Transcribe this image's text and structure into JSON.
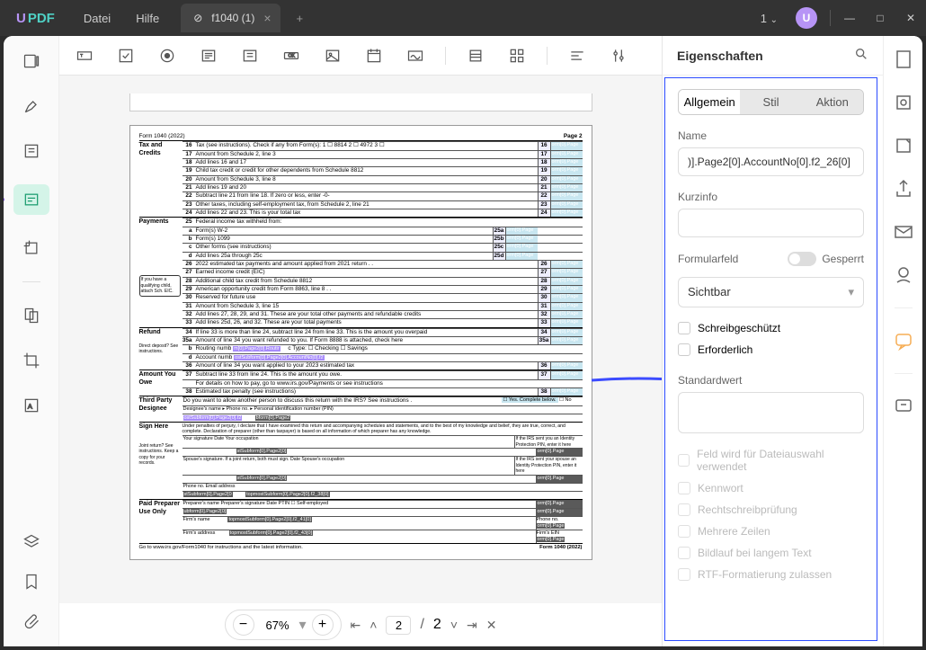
{
  "titlebar": {
    "brand_u": "U",
    "brand_pdf": "PDF",
    "menu_file": "Datei",
    "menu_help": "Hilfe",
    "tab_title": "f1040 (1)",
    "pagecount": "1",
    "avatar": "U"
  },
  "toolbar_icons": [
    "text-field",
    "checkbox",
    "radio",
    "dropdown",
    "listbox",
    "button",
    "image",
    "date",
    "signature",
    "sep",
    "list",
    "grid",
    "sep",
    "align",
    "settings"
  ],
  "leftsidebar_icons": [
    "thumbnails",
    "highlighter",
    "edit-text",
    "form-field",
    "crop-tool",
    "page-organize",
    "crop",
    "ocr"
  ],
  "leftsidebar_bottom": [
    "layers",
    "bookmark",
    "attachment"
  ],
  "rightstrip_icons": [
    "page-icon",
    "stamp-icon",
    "signature-icon",
    "share-icon",
    "mail-icon",
    "save-icon",
    "settings-icon",
    "sep",
    "chat-icon",
    "sep",
    "feedback-icon"
  ],
  "right": {
    "title": "Eigenschaften",
    "tabs": {
      "general": "Allgemein",
      "style": "Stil",
      "action": "Aktion"
    },
    "name_label": "Name",
    "name_value": ")].Page2[0].AccountNo[0].f2_26[0]",
    "tooltip_label": "Kurzinfo",
    "formfield_label": "Formularfeld",
    "locked_label": "Gesperrt",
    "visibility": "Sichtbar",
    "readonly": "Schreibgeschützt",
    "required": "Erforderlich",
    "default_label": "Standardwert",
    "opt_file": "Feld wird für Dateiauswahl verwendet",
    "opt_password": "Kennwort",
    "opt_spellcheck": "Rechtschreibprüfung",
    "opt_multiline": "Mehrere Zeilen",
    "opt_scroll": "Bildlauf bei langem Text",
    "opt_rtf": "RTF-Formatierung zulassen"
  },
  "bottombar": {
    "zoom": "67%",
    "page_current": "2",
    "page_total": "2"
  },
  "pdf": {
    "form_title": "Form 1040 (2022)",
    "page_label": "Page 2",
    "sec_tax": "Tax and Credits",
    "sec_payments": "Payments",
    "sec_refund": "Refund",
    "sec_amount": "Amount You Owe",
    "sec_thirdparty": "Third Party Designee",
    "sec_sign": "Sign Here",
    "sec_preparer": "Paid Preparer Use Only",
    "qualnote": "If you have a qualifying child, attach Sch. EIC.",
    "lines_tax": [
      {
        "n": "16",
        "t": "Tax (see instructions). Check if any from Form(s): 1 ☐ 8814  2 ☐ 4972  3 ☐"
      },
      {
        "n": "17",
        "t": "Amount from Schedule 2, line 3"
      },
      {
        "n": "18",
        "t": "Add lines 16 and 17"
      },
      {
        "n": "19",
        "t": "Child tax credit or credit for other dependents from Schedule 8812"
      },
      {
        "n": "20",
        "t": "Amount from Schedule 3, line 8"
      },
      {
        "n": "21",
        "t": "Add lines 19 and 20"
      },
      {
        "n": "22",
        "t": "Subtract line 21 from line 18. If zero or less, enter -0-"
      },
      {
        "n": "23",
        "t": "Other taxes, including self-employment tax, from Schedule 2, line 21"
      },
      {
        "n": "24",
        "t": "Add lines 22 and 23. This is your total tax"
      }
    ],
    "lines_pay": [
      {
        "n": "25",
        "t": "Federal income tax withheld from:"
      },
      {
        "n": "a",
        "t": "Form(s) W-2"
      },
      {
        "n": "b",
        "t": "Form(s) 1099"
      },
      {
        "n": "c",
        "t": "Other forms (see instructions)"
      },
      {
        "n": "d",
        "t": "Add lines 25a through 25c"
      },
      {
        "n": "26",
        "t": "2022 estimated tax payments and amount applied from 2021 return . ."
      },
      {
        "n": "27",
        "t": "Earned income credit (EIC)"
      },
      {
        "n": "28",
        "t": "Additional child tax credit from Schedule 8812"
      },
      {
        "n": "29",
        "t": "American opportunity credit from Form 8863, line 8 . ."
      },
      {
        "n": "30",
        "t": "Reserved for future use"
      },
      {
        "n": "31",
        "t": "Amount from Schedule 3, line 15"
      },
      {
        "n": "32",
        "t": "Add lines 27, 28, 29, and 31. These are your total other payments and refundable credits"
      },
      {
        "n": "33",
        "t": "Add lines 25d, 26, and 32. These are your total payments"
      }
    ],
    "lines_refund": [
      {
        "n": "34",
        "t": "If line 33 is more than line 24, subtract line 24 from line 33. This is the amount you overpaid"
      },
      {
        "n": "35a",
        "t": "Amount of line 34 you want refunded to you. If Form 8888 is attached, check here"
      },
      {
        "n": "b",
        "t": "Routing numb"
      },
      {
        "n": "d",
        "t": "Account numb"
      },
      {
        "n": "36",
        "t": "Amount of line 34 you want applied to your 2023 estimated tax"
      }
    ],
    "refund_note": "Direct deposit? See instructions.",
    "routing_chip": "m[0].Page2[0].Routir",
    "account_chip": "ostSubform[0].Page2[0].AccountNo[0].f2",
    "ctype": "c Type: ☐ Checking  ☐ Savings",
    "lines_owe": [
      {
        "n": "37",
        "t": "Subtract line 33 from line 24. This is the amount you owe."
      },
      {
        "n": "",
        "t": "For details on how to pay, go to www.irs.gov/Payments or see instructions"
      },
      {
        "n": "38",
        "t": "Estimated tax penalty (see instructions)"
      }
    ],
    "tpd_line1": "Do you want to allow another person to discuss this return with the IRS? See instructions .",
    "tpd_yes": "☐ Yes. Complete below.",
    "tpd_no": "☐ No",
    "tpd_cols": "Designee's name ▸   Phone no. ▸   Personal identification number (PIN)",
    "tpd_chip": "ostSubform[0].Page2[0].f2",
    "tpd_chip2": "bform[0].Page2",
    "sign_text": "Under penalties of perjury, I declare that I have examined this return and accompanying schedules and statements, and to the best of my knowledge and belief, they are true, correct, and complete. Declaration of preparer (other than taxpayer) is based on all information of which preparer has any knowledge.",
    "sign_row1": "Your signature          Date          Your occupation",
    "sign_row2": "Spouse's signature. If a joint return, both must sign.    Date    Spouse's occupation",
    "sign_row3": "Phone no.          Email address",
    "sign_chip": "stSubform[0].Page2[0]",
    "sign_chip2": "stSubform[0].Page2[0",
    "sign_chip3": "topmostSubform[0].Page2[0].f2_38[0]",
    "sign_side": "If the IRS sent you an Identity Protection PIN, enter it here",
    "sign_side2": "If the IRS sent your spouse an Identity Protection PIN, enter it here",
    "joint": "Joint return? See instructions. Keep a copy for your records.",
    "prep_row1": "Preparer's name    Preparer's signature    Date    PTIN    ☐ Self-employed",
    "prep_chip1": "ubform[0].Page2[0]",
    "prep_row2": "Firm's name",
    "prep_chip2": "topmostSubform[0].Page2[0].f2_41[0]",
    "prep_ph": "Phone no.",
    "prep_row3": "Firm's address",
    "prep_chip3": "topmostSubform[0].Page2[0].f2_43[0]",
    "prep_ein": "Firm's EIN",
    "bottom_instr": "Go to www.irs.gov/Form1040 for instructions and the latest information.",
    "bottom_form": "Form 1040 (2022)",
    "fieldchip": "orm[0].Page"
  }
}
